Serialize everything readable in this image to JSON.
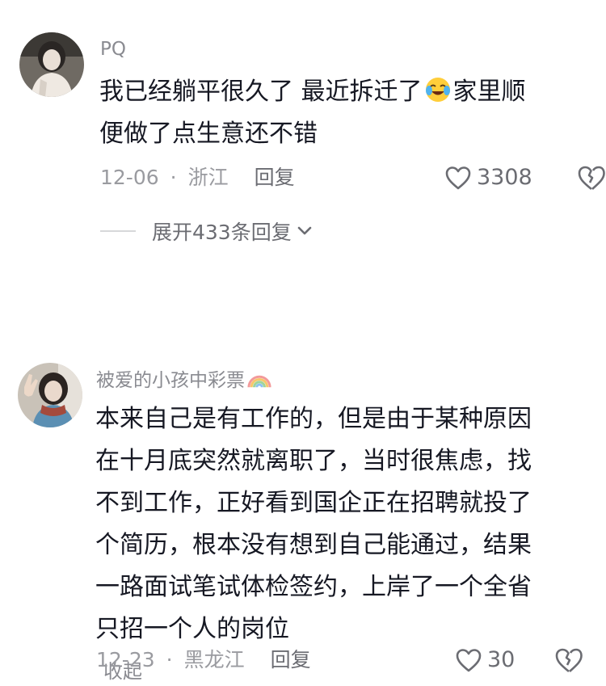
{
  "comments": [
    {
      "username": "PQ",
      "text_lines_1": "我已经躺平很久了 最近拆迁了",
      "text_lines_1b": "家里顺",
      "text_lines_2": "便做了点生意还不错",
      "date": "12-06",
      "separator": "·",
      "location": "浙江",
      "reply_label": "回复",
      "like_count": "3308",
      "expand_replies": "展开433条回复"
    },
    {
      "username": "被爱的小孩中彩票",
      "lines": [
        "本来自己是有工作的，但是由于某种原因",
        "在十月底突然就离职了，当时很焦虑，找",
        "不到工作，正好看到国企正在招聘就投了",
        "个简历，根本没有想到自己能通过，结果",
        "一路面试笔试体检签约，上岸了一个全省",
        "只招一个人的岗位"
      ],
      "collapse_label": "收起",
      "date": "12-23",
      "separator": "·",
      "location": "黑龙江",
      "reply_label": "回复",
      "like_count": "30"
    }
  ],
  "icons": {
    "like": "heart-outline-icon",
    "dislike": "broken-heart-icon",
    "expand": "chevron-down-icon",
    "emoji": "tears-of-joy-emoji",
    "rainbow": "rainbow-emoji"
  }
}
